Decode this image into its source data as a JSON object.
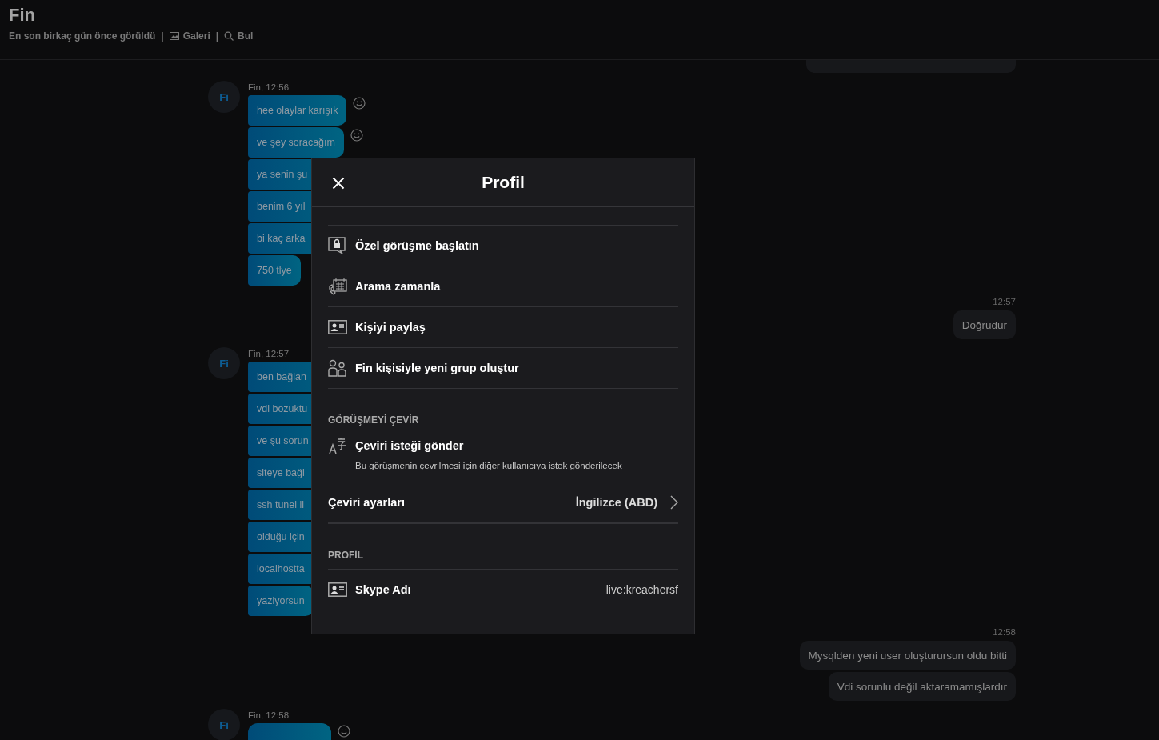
{
  "header": {
    "title": "Fin",
    "status": "En son birkaç gün önce görüldü",
    "links": [
      {
        "separator": "|",
        "label": "Galeri",
        "kind": "gallery"
      },
      {
        "separator": "|",
        "label": "Bul",
        "kind": "search"
      }
    ]
  },
  "chat": [
    {
      "kind": "outgoing",
      "messages": [
        {
          "kind": "cut"
        }
      ]
    },
    {
      "kind": "incoming",
      "avatar": "Fi",
      "meta": "Fin, 12:56",
      "messages": [
        {
          "kind": "text",
          "text": "hee olaylar karışık",
          "reaction": true
        },
        {
          "kind": "text",
          "text": "ve şey soracağım",
          "reaction": true
        },
        {
          "kind": "covered",
          "text": "ya senin şu",
          "reaction": false
        },
        {
          "kind": "covered",
          "text": "benim 6 yıl",
          "reaction": false
        },
        {
          "kind": "covered",
          "text": "bi kaç arka",
          "reaction": false
        },
        {
          "kind": "text",
          "text": "750 tlye",
          "reaction": false
        }
      ]
    },
    {
      "kind": "outgoing",
      "time": "12:57",
      "messages": [
        {
          "kind": "text",
          "text": "Doğrudur"
        }
      ]
    },
    {
      "kind": "incoming",
      "avatar": "Fi",
      "meta": "Fin, 12:57",
      "messages": [
        {
          "kind": "covered",
          "text": "ben bağlan",
          "reaction": false
        },
        {
          "kind": "covered",
          "text": "vdi bozuktu",
          "reaction": false
        },
        {
          "kind": "covered",
          "text": "ve şu sorun",
          "reaction": false
        },
        {
          "kind": "covered",
          "text": "siteye bağl",
          "reaction": false
        },
        {
          "kind": "covered",
          "text": "ssh tunel il",
          "reaction": false
        },
        {
          "kind": "covered",
          "text": "olduğu için",
          "reaction": false
        },
        {
          "kind": "covered",
          "text": "localhostta",
          "reaction": false
        },
        {
          "kind": "text",
          "text": "yaziyorsun",
          "reaction": false
        }
      ]
    },
    {
      "kind": "outgoing",
      "time": "12:58",
      "messages": [
        {
          "kind": "text",
          "text": "Mysqlden yeni user oluşturursun oldu bitti"
        },
        {
          "kind": "text",
          "text": "Vdi sorunlu değil aktaramamışlardır"
        }
      ]
    },
    {
      "kind": "incoming",
      "avatar": "Fi",
      "meta": "Fin, 12:58",
      "messages": [
        {
          "kind": "cut",
          "reaction": true
        }
      ]
    }
  ],
  "dialog": {
    "title": "Profil",
    "actions": [
      {
        "label": "Özel görüşme başlatın"
      },
      {
        "label": "Arama zamanla"
      },
      {
        "label": "Kişiyi paylaş"
      },
      {
        "label": "Fin kişisiyle yeni grup oluştur"
      }
    ],
    "translate": {
      "heading": "GÖRÜŞMEYİ ÇEVİR",
      "request": {
        "label": "Çeviri isteği gönder",
        "description": "Bu görüşmenin çevrilmesi için diğer kullanıcıya istek gönderilecek"
      },
      "settings": {
        "label": "Çeviri ayarları",
        "value": "İngilizce (ABD)"
      }
    },
    "profile": {
      "heading": "PROFİL",
      "rows": [
        {
          "label": "Skype Adı",
          "value": "live:kreachersf"
        }
      ]
    }
  }
}
